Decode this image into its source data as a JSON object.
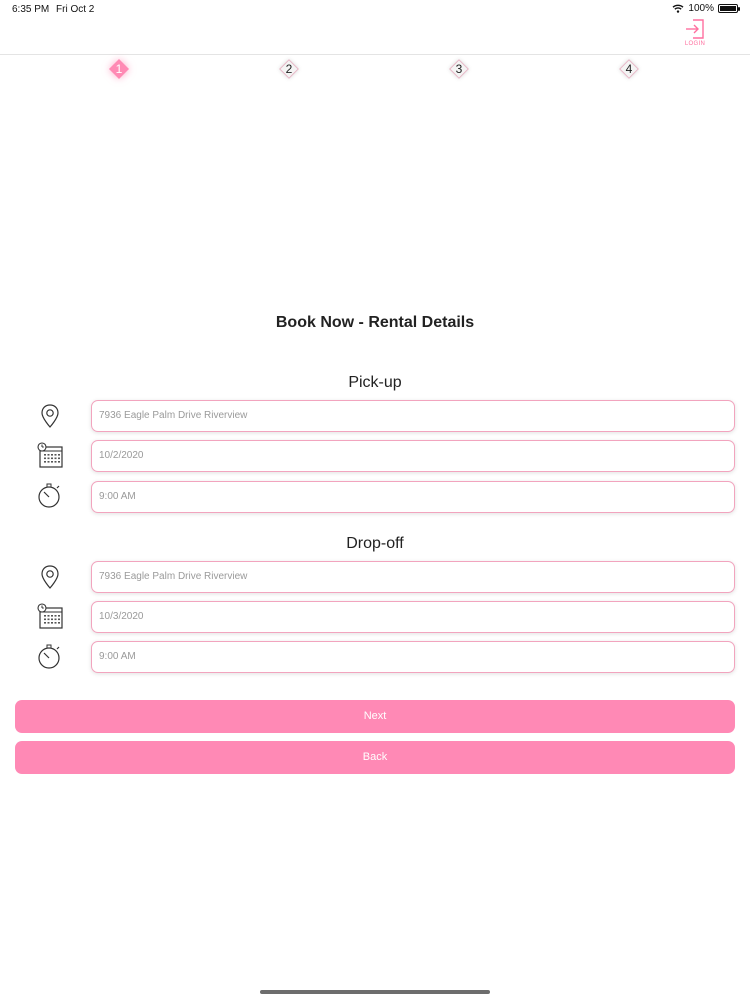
{
  "status": {
    "time": "6:35 PM",
    "date": "Fri Oct 2",
    "battery": "100%",
    "battery_level": 1.0
  },
  "header": {
    "login_label": "LOGIN"
  },
  "steps": [
    {
      "label": "1",
      "active": true
    },
    {
      "label": "2",
      "active": false
    },
    {
      "label": "3",
      "active": false
    },
    {
      "label": "4",
      "active": false
    }
  ],
  "title": "Book Now - Rental Details",
  "pickup": {
    "heading": "Pick-up",
    "location": "7936 Eagle Palm Drive Riverview",
    "date": "10/2/2020",
    "time": "9:00 AM"
  },
  "dropoff": {
    "heading": "Drop-off",
    "location": "7936 Eagle Palm Drive Riverview",
    "date": "10/3/2020",
    "time": "9:00 AM"
  },
  "buttons": {
    "next": "Next",
    "back": "Back"
  },
  "colors": {
    "accent": "#ff89b5",
    "field_border": "#f2a4be"
  },
  "icons": [
    "wifi-icon",
    "battery-icon",
    "login-icon",
    "location-pin-icon",
    "calendar-icon",
    "stopwatch-icon"
  ]
}
